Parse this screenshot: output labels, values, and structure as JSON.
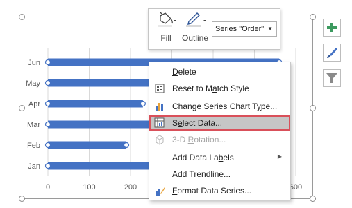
{
  "mini_toolbar": {
    "fill_label": "Fill",
    "outline_label": "Outline",
    "series_selected": "Series \"Order\""
  },
  "context_menu": {
    "items": [
      {
        "key": "delete",
        "pre": "",
        "ul": "D",
        "post": "elete",
        "enabled": true
      },
      {
        "key": "reset",
        "pre": "Reset to M",
        "ul": "a",
        "post": "tch Style",
        "enabled": true
      },
      {
        "key": "change_type",
        "pre": "Change Series Chart T",
        "ul": "y",
        "post": "pe...",
        "enabled": true
      },
      {
        "key": "select_data",
        "pre": "S",
        "ul": "e",
        "post": "lect Data...",
        "enabled": true,
        "selected": true
      },
      {
        "key": "rotation",
        "pre": "3-D ",
        "ul": "R",
        "post": "otation...",
        "enabled": false
      },
      {
        "key": "data_labels",
        "pre": "Add Data La",
        "ul": "b",
        "post": "els",
        "enabled": true,
        "submenu": true
      },
      {
        "key": "trendline",
        "pre": "Add T",
        "ul": "r",
        "post": "endline...",
        "enabled": true
      },
      {
        "key": "format_series",
        "pre": "",
        "ul": "F",
        "post": "ormat Data Series...",
        "enabled": true
      }
    ]
  },
  "side_buttons": [
    "plus-icon",
    "brush-icon",
    "filter-icon"
  ],
  "colors": {
    "bar": "#4472c4",
    "gridline": "#d9d9d9",
    "axis_text": "#595959",
    "selection_outline": "#d9505a",
    "chart_elements_icon": "#3c9a5f"
  },
  "chart_data": {
    "type": "bar",
    "orientation": "horizontal",
    "categories": [
      "Jan",
      "Feb",
      "Mar",
      "Apr",
      "May",
      "Jun"
    ],
    "series": [
      {
        "values": [
          480,
          190,
          470,
          230,
          490,
          560
        ]
      }
    ],
    "xlim": [
      0,
      600
    ],
    "x_ticks": [
      "0",
      "100",
      "200",
      "",
      "",
      "",
      "600"
    ],
    "grid": true
  }
}
